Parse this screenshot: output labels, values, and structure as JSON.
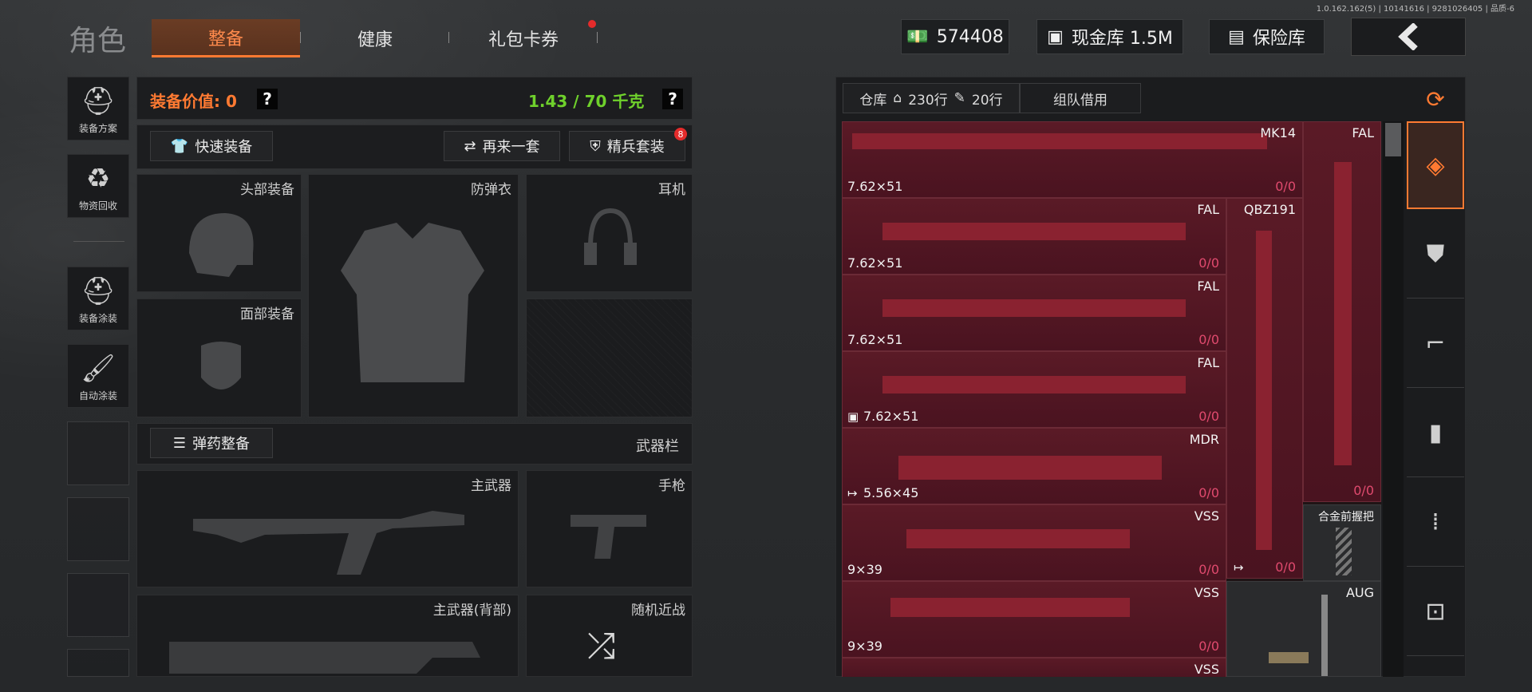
{
  "version": "1.0.162.162(5) | 10141616 | 9281026405 | 品质-6",
  "title": "角色",
  "tabs": [
    {
      "label": "整备"
    },
    {
      "label": "健康"
    },
    {
      "label": "礼包卡券"
    }
  ],
  "currency": {
    "money": "574408",
    "cash_vault": "现金库 1.5M",
    "safe_box": "保险库"
  },
  "sidebar": [
    {
      "label": "装备方案",
      "icon": "loadout-icon"
    },
    {
      "label": "物资回收",
      "icon": "recycle-icon"
    },
    {
      "label": "装备涂装",
      "icon": "skin-icon"
    },
    {
      "label": "自动涂装",
      "icon": "auto-paint-icon"
    }
  ],
  "equipment": {
    "value_label": "装备价值: 0",
    "help": "?",
    "weight": "1.43 / 70 千克",
    "quick_equip": "快速装备",
    "again": "再来一套",
    "elite": "精兵套装",
    "elite_badge": "8",
    "slots": {
      "head": "头部装备",
      "armor": "防弹衣",
      "headset": "耳机",
      "face": "面部装备",
      "primary": "主武器",
      "pistol": "手枪",
      "primary_back": "主武器(背部)",
      "melee": "随机近战"
    },
    "ammo_btn": "弹药整备",
    "weapon_bar": "武器栏"
  },
  "inventory": {
    "tabs": [
      {
        "label": "仓库"
      },
      {
        "label": "230行"
      },
      {
        "label": "20行"
      },
      {
        "label": "组队借用"
      }
    ],
    "items": [
      {
        "name": "MK14",
        "caliber": "7.62×51",
        "count": "0/0"
      },
      {
        "name": "FAL",
        "count": "0/0"
      },
      {
        "name": "FAL",
        "caliber": "7.62×51",
        "count": "0/0"
      },
      {
        "name": "QBZ191",
        "count": "0/0"
      },
      {
        "name": "FAL",
        "caliber": "7.62×51",
        "count": "0/0"
      },
      {
        "name": "FAL",
        "caliber": "7.62×51",
        "count": "0/0"
      },
      {
        "name": "MDR",
        "caliber": "5.56×45",
        "count": "0/0"
      },
      {
        "name": "VSS",
        "caliber": "9×39",
        "count": "0/0"
      },
      {
        "name": "合金前握把"
      },
      {
        "name": "VSS",
        "caliber": "9×39",
        "count": "0/0"
      },
      {
        "name": "AUG"
      },
      {
        "name": "VSS"
      }
    ]
  },
  "colors": {
    "accent": "#ff7a32",
    "item_bg": "#4a1320",
    "count": "#e04a6e",
    "weight": "#6fd12c"
  }
}
